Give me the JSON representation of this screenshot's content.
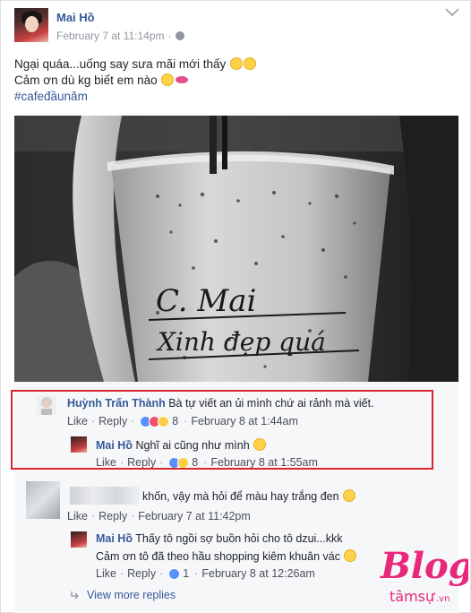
{
  "post": {
    "author": "Mai Hồ",
    "timestamp": "February 7 at 11:14pm",
    "dot": "·",
    "line1": "Ngại quáa...uống say sưa mãi mới thấy",
    "line2": "Cảm ơn dù kg biết em nào",
    "hashtag": "#cafeđầunăm",
    "photo_text_line1": "C. Mai",
    "photo_text_line2": "Xinh đẹp quá"
  },
  "comments": [
    {
      "author": "Huỳnh Trấn Thành",
      "text": "Bà tự viết an ủi mình chứ ai rảnh mà viết.",
      "like": "Like",
      "reply": "Reply",
      "reactions": "8",
      "time": "February 8 at 1:44am"
    },
    {
      "author": "Mai Hồ",
      "text": "Nghĩ ai cũng như mình",
      "like": "Like",
      "reply": "Reply",
      "reactions": "8",
      "time": "February 8 at 1:55am"
    },
    {
      "author": "",
      "text": "khốn, vậy mà hỏi để màu hay trắng đen",
      "like": "Like",
      "reply": "Reply",
      "time": "February 7 at 11:42pm"
    },
    {
      "author": "Mai Hồ",
      "text": "Thấy tô ngồi sợ buồn hỏi cho tô dzui...kkk",
      "text2": "Cảm ơn tô đã theo hầu shopping kiêm khuân vác",
      "like": "Like",
      "reply": "Reply",
      "reactions": "1",
      "time": "February 8 at 12:26am"
    }
  ],
  "view_more": "View more replies",
  "watermark": {
    "brand": "Blog",
    "sub": "tâmsự",
    "tld": ".vn"
  },
  "colors": {
    "link": "#365899",
    "highlight": "#d9262b",
    "watermark": "#e8287a"
  }
}
